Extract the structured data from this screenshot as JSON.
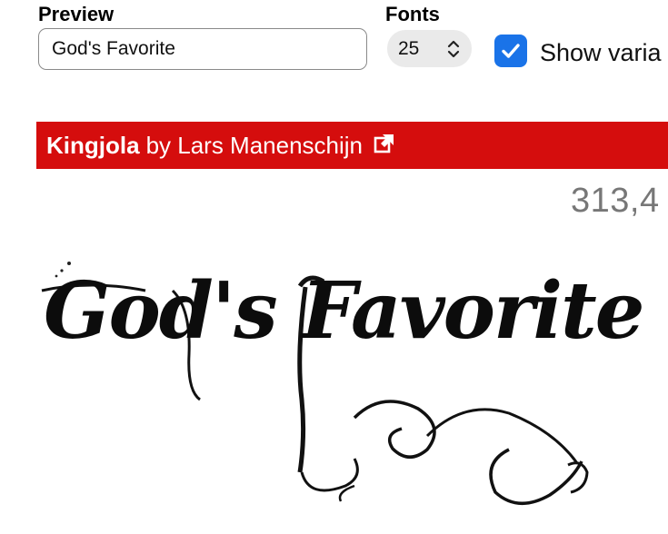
{
  "controls": {
    "preview_label": "Preview",
    "fonts_label": "Fonts",
    "preview_value": "God's Favorite",
    "font_count_value": "25",
    "show_variants_label": "Show varia",
    "show_variants_checked": true
  },
  "font_card": {
    "font_name": "Kingjola",
    "by_text": "by Lars Manenschijn",
    "download_count": "313,4",
    "sample_text": "God's Favorite"
  },
  "colors": {
    "header_red": "#d50d0d",
    "checkbox_blue": "#1a73e8",
    "count_gray": "#777777"
  },
  "icons": {
    "stepper": "up-down-chevron-icon",
    "checkbox": "checkmark-icon",
    "external": "external-link-icon"
  }
}
